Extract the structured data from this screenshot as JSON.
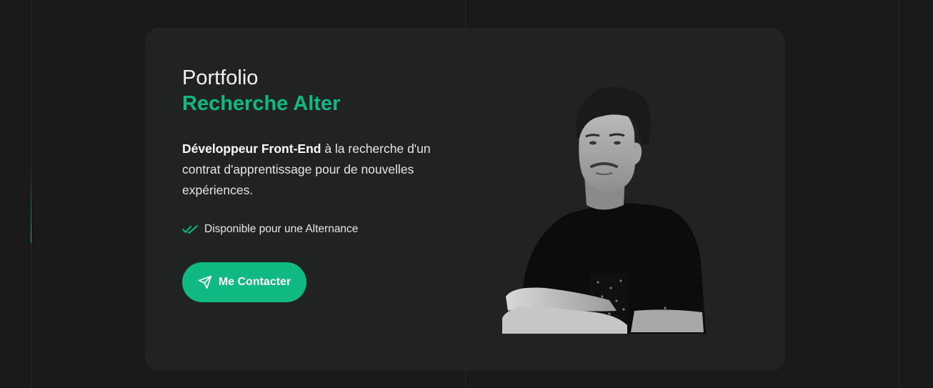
{
  "hero": {
    "title": "Portfolio",
    "subtitle": "Recherche Alter",
    "description_bold": "Développeur Front-End",
    "description_rest": " à la recherche d'un contrat d'apprentissage pour de nouvelles expériences.",
    "availability_text": "Disponible pour une Alternance",
    "cta_label": "Me Contacter",
    "icons": {
      "availability": "double-check-icon",
      "cta": "send-icon"
    }
  },
  "colors": {
    "accent": "#10b981",
    "background": "#19191b",
    "card": "#212224",
    "text": "#e6e6e6"
  }
}
